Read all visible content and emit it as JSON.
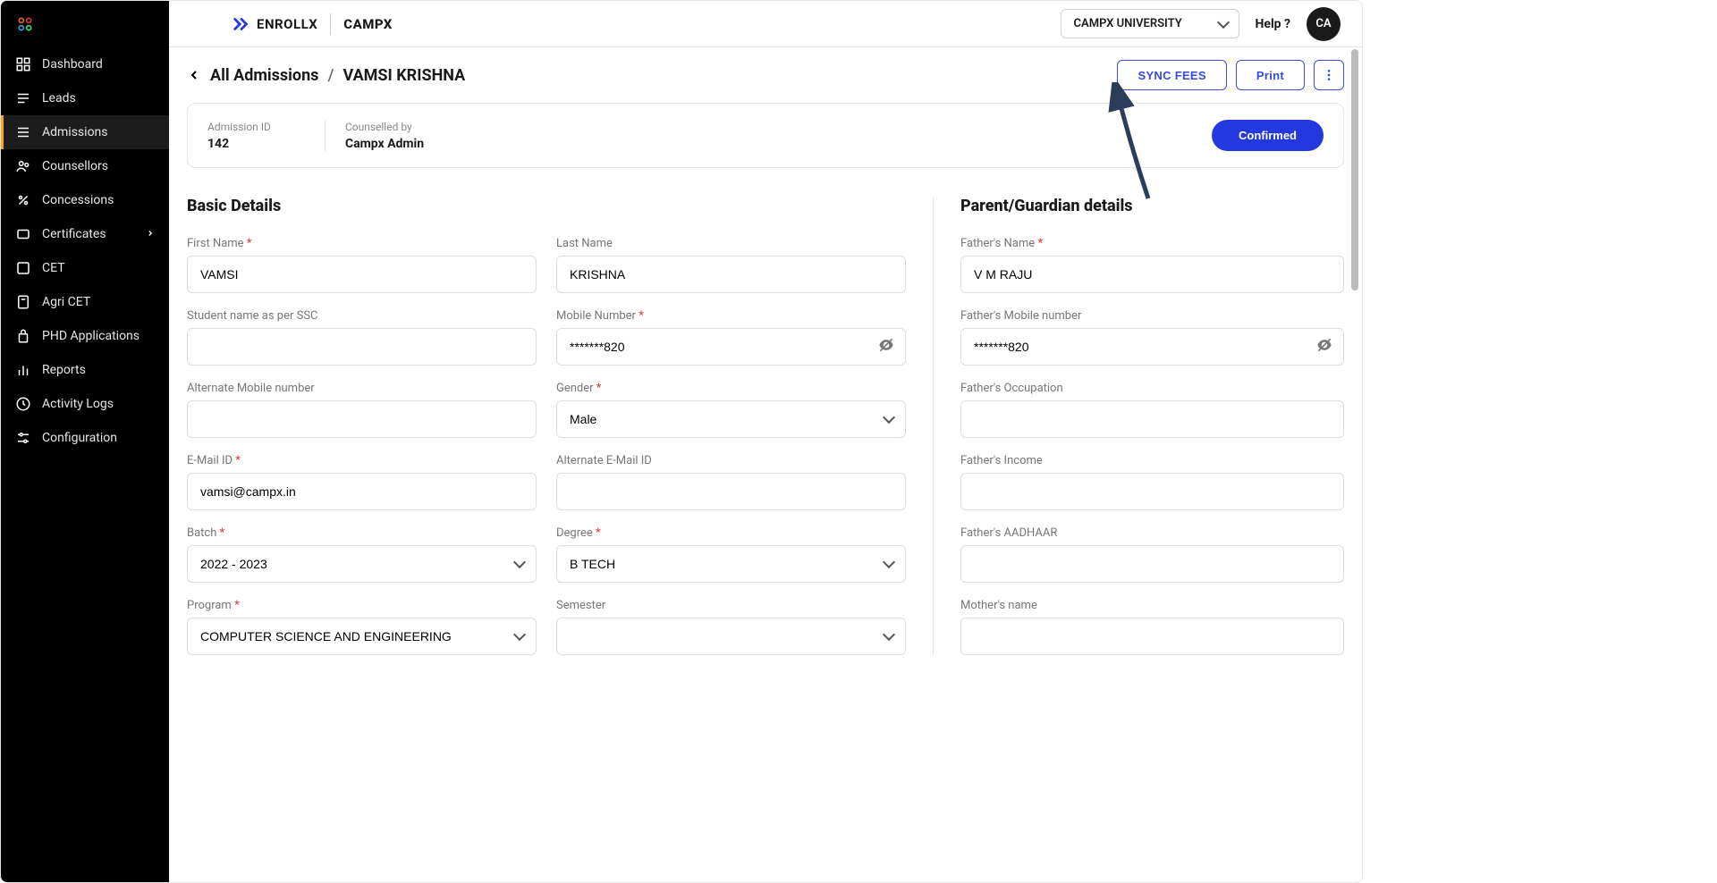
{
  "brand": {
    "app": "ENROLLX",
    "suite": "CAMPX"
  },
  "header": {
    "tenant": "CAMPX UNIVERSITY",
    "help": "Help ?",
    "avatar": "CA"
  },
  "sidebar": {
    "items": [
      {
        "label": "Dashboard",
        "icon": "dashboard-icon"
      },
      {
        "label": "Leads",
        "icon": "leads-icon"
      },
      {
        "label": "Admissions",
        "icon": "admissions-icon",
        "active": true
      },
      {
        "label": "Counsellors",
        "icon": "counsellors-icon"
      },
      {
        "label": "Concessions",
        "icon": "concessions-icon"
      },
      {
        "label": "Certificates",
        "icon": "certificates-icon",
        "submenu": true
      },
      {
        "label": "CET",
        "icon": "cet-icon"
      },
      {
        "label": "Agri CET",
        "icon": "agri-cet-icon"
      },
      {
        "label": "PHD Applications",
        "icon": "phd-icon"
      },
      {
        "label": "Reports",
        "icon": "reports-icon"
      },
      {
        "label": "Activity Logs",
        "icon": "activity-icon"
      },
      {
        "label": "Configuration",
        "icon": "config-icon"
      }
    ]
  },
  "breadcrumb": {
    "parent": "All Admissions",
    "sep": "/",
    "current": "VAMSI KRISHNA"
  },
  "actions": {
    "sync_fees": "SYNC FEES",
    "print": "Print"
  },
  "info": {
    "admission_id_label": "Admission ID",
    "admission_id_value": "142",
    "counselled_label": "Counselled by",
    "counselled_value": "Campx Admin",
    "confirmed": "Confirmed"
  },
  "sections": {
    "basic": "Basic Details",
    "parent": "Parent/Guardian details"
  },
  "fields": {
    "first_name": {
      "label": "First Name",
      "value": "VAMSI",
      "required": true
    },
    "last_name": {
      "label": "Last Name",
      "value": "KRISHNA",
      "required": false
    },
    "ssc_name": {
      "label": "Student name as per SSC",
      "value": "",
      "required": false
    },
    "mobile": {
      "label": "Mobile Number",
      "value": "*******820",
      "required": true
    },
    "alt_mobile": {
      "label": "Alternate Mobile number",
      "value": "",
      "required": false
    },
    "gender": {
      "label": "Gender",
      "value": "Male",
      "required": true
    },
    "email": {
      "label": "E-Mail ID",
      "value": "vamsi@campx.in",
      "required": true
    },
    "alt_email": {
      "label": "Alternate E-Mail ID",
      "value": "",
      "required": false
    },
    "batch": {
      "label": "Batch",
      "value": "2022 - 2023",
      "required": true
    },
    "degree": {
      "label": "Degree",
      "value": "B TECH",
      "required": true
    },
    "program": {
      "label": "Program",
      "value": "COMPUTER SCIENCE AND ENGINEERING",
      "required": true
    },
    "semester": {
      "label": "Semester",
      "value": "",
      "required": false
    },
    "father_name": {
      "label": "Father's Name",
      "value": "V M RAJU",
      "required": true
    },
    "father_mobile": {
      "label": "Father's Mobile number",
      "value": "*******820",
      "required": false
    },
    "father_occupation": {
      "label": "Father's Occupation",
      "value": "",
      "required": false
    },
    "father_income": {
      "label": "Father's Income",
      "value": "",
      "required": false
    },
    "father_aadhaar": {
      "label": "Father's AADHAAR",
      "value": "",
      "required": false
    },
    "mother_name": {
      "label": "Mother's name",
      "value": "",
      "required": false
    }
  },
  "req_mark": "*"
}
